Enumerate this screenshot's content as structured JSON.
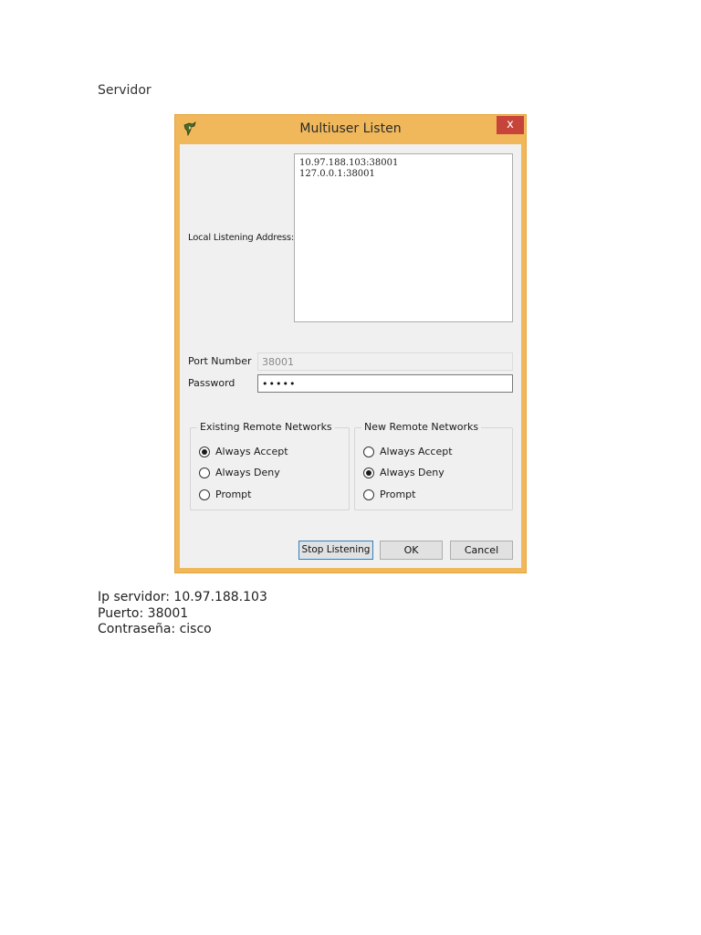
{
  "doc": {
    "heading": "Servidor",
    "lines": [
      "Ip servidor: 10.97.188.103",
      "Puerto: 38001",
      "Contraseña: cisco"
    ]
  },
  "dialog": {
    "title": "Multiuser Listen",
    "close_label": "x",
    "local_listening_label": "Local Listening Address:",
    "addresses": [
      "10.97.188.103:38001",
      "127.0.0.1:38001"
    ],
    "port_label": "Port Number",
    "port_value": "38001",
    "password_label": "Password",
    "password_masked": "•••••",
    "existing": {
      "title": "Existing Remote Networks",
      "options": [
        {
          "label": "Always Accept",
          "selected": true
        },
        {
          "label": "Always Deny",
          "selected": false
        },
        {
          "label": "Prompt",
          "selected": false
        }
      ]
    },
    "new": {
      "title": "New Remote Networks",
      "options": [
        {
          "label": "Always Accept",
          "selected": false
        },
        {
          "label": "Always Deny",
          "selected": true
        },
        {
          "label": "Prompt",
          "selected": false
        }
      ]
    },
    "buttons": {
      "stop": "Stop Listening",
      "ok": "OK",
      "cancel": "Cancel"
    },
    "colors": {
      "frame": "#f0b85a",
      "close": "#c7443a",
      "client": "#f0f0f0"
    }
  }
}
